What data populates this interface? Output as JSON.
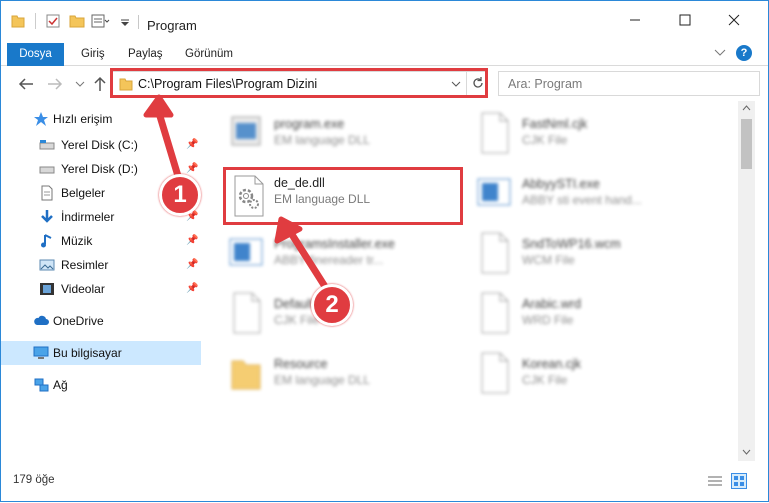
{
  "window": {
    "title": "Program",
    "minimize_icon": "minimize-icon",
    "maximize_icon": "maximize-icon",
    "close_icon": "close-icon"
  },
  "ribbon": {
    "tabs": [
      {
        "label": "Dosya"
      },
      {
        "label": "Giriş"
      },
      {
        "label": "Paylaş"
      },
      {
        "label": "Görünüm"
      }
    ],
    "help_label": "?"
  },
  "nav": {
    "path": "C:\\Program Files\\Program Dizini",
    "search_placeholder": "Ara: Program"
  },
  "sidebar": {
    "items": [
      {
        "label": "Hızlı erişim",
        "icon": "star-icon",
        "pinned": false
      },
      {
        "label": "Yerel Disk (C:)",
        "icon": "drive-icon",
        "pinned": true
      },
      {
        "label": "Yerel Disk (D:)",
        "icon": "drive-icon",
        "pinned": true
      },
      {
        "label": "Belgeler",
        "icon": "documents-icon",
        "pinned": true
      },
      {
        "label": "İndirmeler",
        "icon": "download-icon",
        "pinned": true
      },
      {
        "label": "Müzik",
        "icon": "music-icon",
        "pinned": true
      },
      {
        "label": "Resimler",
        "icon": "pictures-icon",
        "pinned": true
      },
      {
        "label": "Videolar",
        "icon": "videos-icon",
        "pinned": true
      },
      {
        "label": "OneDrive",
        "icon": "cloud-icon",
        "pinned": false
      },
      {
        "label": "Bu bilgisayar",
        "icon": "computer-icon",
        "pinned": false
      },
      {
        "label": "Ağ",
        "icon": "network-icon",
        "pinned": false
      }
    ]
  },
  "files": [
    {
      "name": "program.exe",
      "type": "EM language DLL"
    },
    {
      "name": "FastNml.cjk",
      "type": "CJK File"
    },
    {
      "name": "de_de.dll",
      "type": "EM language DLL"
    },
    {
      "name": "AbbyySTI.exe",
      "type": "ABBY sti event hand..."
    },
    {
      "name": "ProgramsInstaller.exe",
      "type": "ABBY finereader tr..."
    },
    {
      "name": "SndToWP16.wcm",
      "type": "WCM File"
    },
    {
      "name": "Default.cjk",
      "type": "CJK File"
    },
    {
      "name": "Arabic.wrd",
      "type": "WRD File"
    },
    {
      "name": "Resource",
      "type": "EM language DLL"
    },
    {
      "name": "Korean.cjk",
      "type": "CJK File"
    }
  ],
  "status": {
    "count": "179 öğe"
  },
  "badges": {
    "one": "1",
    "two": "2"
  },
  "colors": {
    "accent": "#1979ca",
    "highlight_red": "#e03c40",
    "selected_bg": "#cce8ff"
  }
}
